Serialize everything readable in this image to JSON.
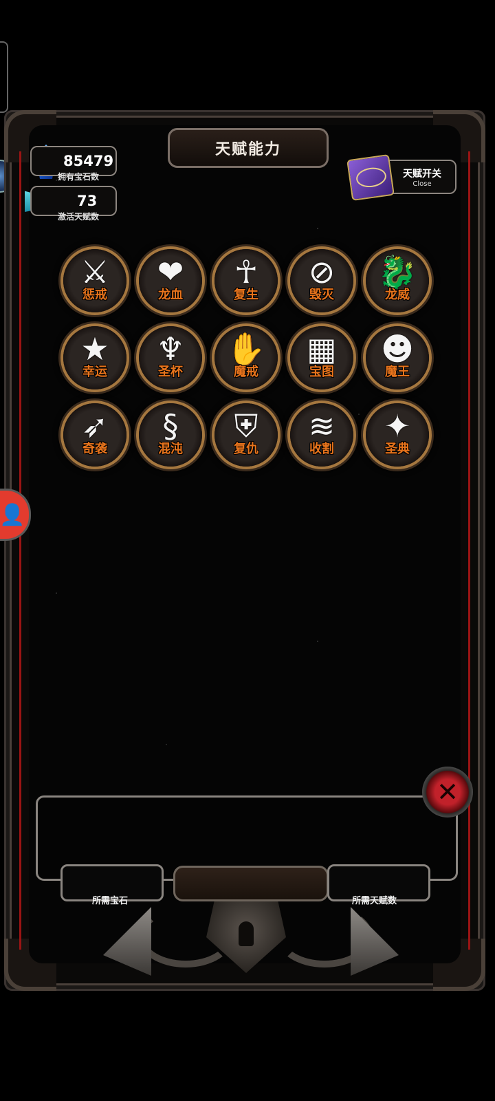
{
  "title": "天赋能力",
  "stats": {
    "gems": {
      "value": "85479",
      "label": "拥有宝石数"
    },
    "talents": {
      "value": "73",
      "label": "激活天赋数"
    }
  },
  "toggle": {
    "label": "天赋开关",
    "sub": "Close"
  },
  "talents": [
    {
      "name": "惩戒",
      "icon": "winged-sword-icon",
      "glyph": "⚔"
    },
    {
      "name": "龙血",
      "icon": "dragon-heart-icon",
      "glyph": "❤"
    },
    {
      "name": "复生",
      "icon": "ankh-icon",
      "glyph": "☥"
    },
    {
      "name": "毁灭",
      "icon": "slash-ring-icon",
      "glyph": "⊘"
    },
    {
      "name": "龙威",
      "icon": "dragon-head-icon",
      "glyph": "🐉"
    },
    {
      "name": "幸运",
      "icon": "star-icon",
      "glyph": "★"
    },
    {
      "name": "圣杯",
      "icon": "chalice-icon",
      "glyph": "♆"
    },
    {
      "name": "魔戒",
      "icon": "hand-icon",
      "glyph": "✋"
    },
    {
      "name": "宝图",
      "icon": "treasure-map-icon",
      "glyph": "▦"
    },
    {
      "name": "魔王",
      "icon": "fanged-mouth-icon",
      "glyph": "☻"
    },
    {
      "name": "奇袭",
      "icon": "spear-strike-icon",
      "glyph": "➶"
    },
    {
      "name": "混沌",
      "icon": "chaos-serpent-icon",
      "glyph": "§"
    },
    {
      "name": "复仇",
      "icon": "shield-icon",
      "glyph": "⛨"
    },
    {
      "name": "收割",
      "icon": "claw-slash-icon",
      "glyph": "≋"
    },
    {
      "name": "圣典",
      "icon": "holy-book-icon",
      "glyph": "✦"
    }
  ],
  "bottom": {
    "required_gems_label": "所需宝石",
    "required_talents_label": "所需天赋数"
  }
}
